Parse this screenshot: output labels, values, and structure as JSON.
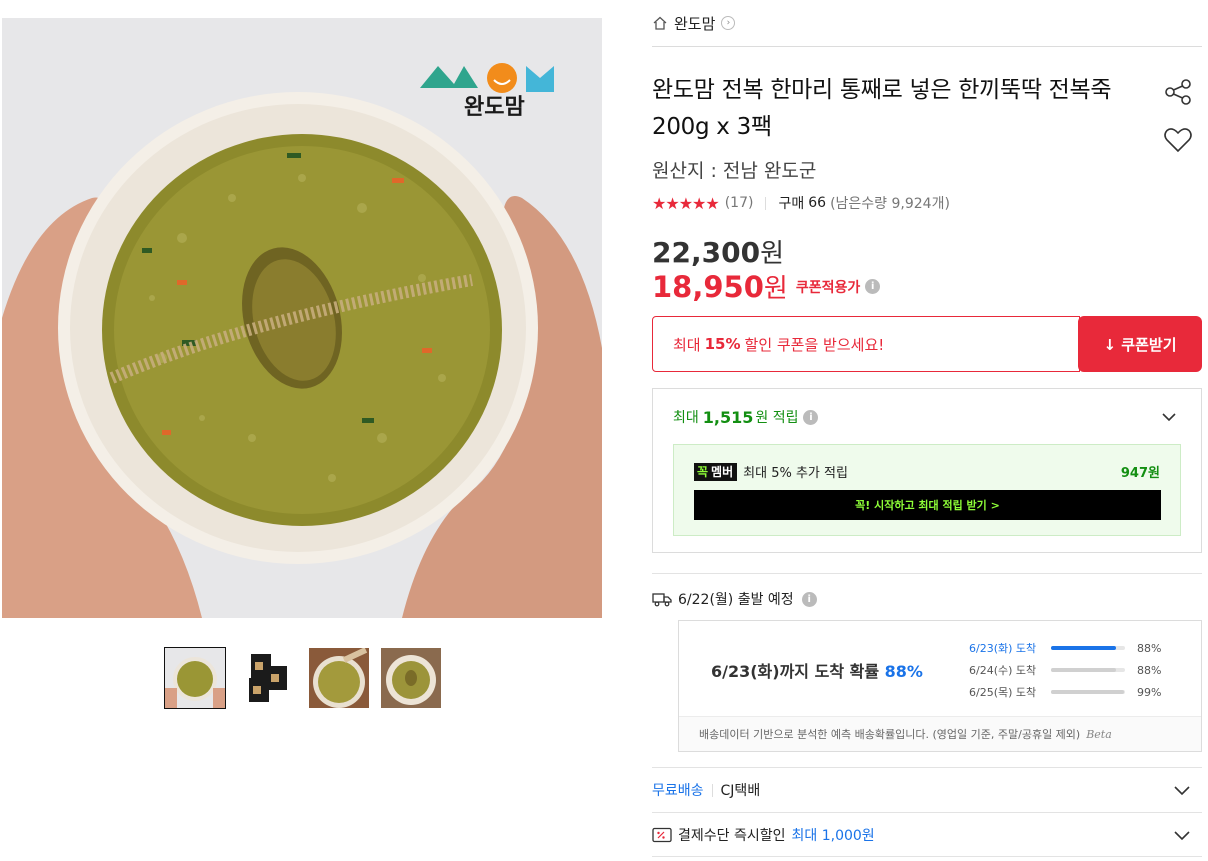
{
  "gallery": {
    "logo_text": "MOM",
    "logo_sub": "완도맘",
    "thumbnails": [
      "thumb-1",
      "thumb-2",
      "thumb-3",
      "thumb-4"
    ]
  },
  "breadcrumb": {
    "store": "완도맘"
  },
  "product": {
    "title": "완도맘 전복 한마리 통째로 넣은 한끼뚝딱 전복죽 200g x 3팩",
    "origin": "원산지 : 전남 완도군",
    "stars": "★★★★★",
    "review_count": "(17)",
    "buy_label": "구매",
    "buy_count": "66",
    "stock": "(남은수량 9,924개)"
  },
  "price": {
    "original_value": "22,300",
    "sale_value": "18,950",
    "won": "원",
    "coupon_applied": "쿠폰적용가"
  },
  "coupon": {
    "msg_prefix": "최대",
    "msg_pct": "15%",
    "msg_suffix": "할인 쿠폰을 받으세요!",
    "button": "↓ 쿠폰받기"
  },
  "points": {
    "prefix": "최대",
    "amount": "1,515",
    "suffix": "원 적립",
    "member_badge_1": "꼭",
    "member_badge_2": "멤버",
    "member_text": "최대 5% 추가 적립",
    "member_amount": "947원",
    "member_button": "꼭! 시작하고 최대 적립 받기 >"
  },
  "shipping": {
    "depart": "6/22(월) 출발 예정",
    "summary_prefix": "6/23(화)까지 도착 확률",
    "summary_pct": "88%",
    "rows": [
      {
        "label": "6/23(화) 도착",
        "value": "88%",
        "fraction": 0.88
      },
      {
        "label": "6/24(수) 도착",
        "value": "88%",
        "fraction": 0.88
      },
      {
        "label": "6/25(목) 도착",
        "value": "99%",
        "fraction": 0.99
      }
    ],
    "note": "배송데이터 기반으로 분석한 예측 배송확률입니다. (영업일 기준, 주말/공휴일 제외)",
    "beta": "Beta",
    "free": "무료배송",
    "carrier": "CJ택배"
  },
  "payment": {
    "label": "결제수단 즉시할인",
    "max": "최대 1,000원"
  },
  "colors": {
    "accent_red": "#e8293a",
    "points_green": "#138f12",
    "link_blue": "#1a73e8",
    "member_lime": "#8fff38"
  }
}
